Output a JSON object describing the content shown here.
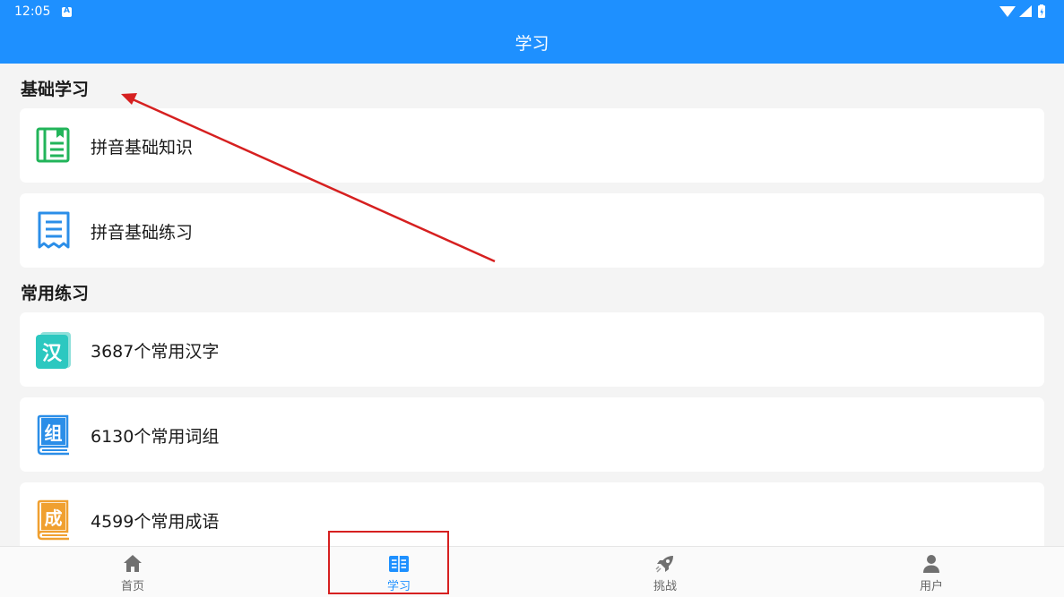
{
  "status_bar": {
    "time": "12:05",
    "notification_badge": "A"
  },
  "app_bar": {
    "title": "学习"
  },
  "sections": [
    {
      "title": "基础学习",
      "items": [
        {
          "label": "拼音基础知识",
          "icon": "book-list-icon",
          "color": "#22b45a"
        },
        {
          "label": "拼音基础练习",
          "icon": "receipt-list-icon",
          "color": "#2b8ee8"
        }
      ]
    },
    {
      "title": "常用练习",
      "items": [
        {
          "label": "3687个常用汉字",
          "icon": "hanzi-icon",
          "glyph": "汉",
          "color": "#2cc8c0"
        },
        {
          "label": "6130个常用词组",
          "icon": "cizu-book-icon",
          "glyph": "组",
          "color": "#2b8ee8"
        },
        {
          "label": "4599个常用成语",
          "icon": "chengyu-book-icon",
          "glyph": "成",
          "color": "#f0a030"
        }
      ]
    }
  ],
  "bottom_nav": {
    "items": [
      {
        "label": "首页",
        "icon": "home-icon"
      },
      {
        "label": "学习",
        "icon": "open-book-icon",
        "active": true
      },
      {
        "label": "挑战",
        "icon": "rocket-icon"
      },
      {
        "label": "用户",
        "icon": "user-icon"
      }
    ]
  },
  "colors": {
    "primary": "#1e90ff",
    "annotation": "#d62020",
    "background": "#f4f4f4"
  }
}
